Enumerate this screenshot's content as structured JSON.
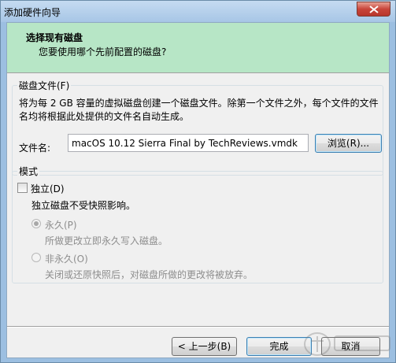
{
  "window": {
    "title": "添加硬件向导"
  },
  "header": {
    "title": "选择现有磁盘",
    "subtitle": "您要使用哪个先前配置的磁盘?"
  },
  "disk_file": {
    "group_label": "磁盘文件(F)",
    "description": "将为每 2 GB 容量的虚拟磁盘创建一个磁盘文件。除第一个文件之外，每个文件的文件名均将根据此处提供的文件名自动生成。",
    "file_label": "文件名:",
    "file_value": "macOS 10.12 Sierra Final by TechReviews.vmdk",
    "browse_label": "浏览(R)..."
  },
  "mode": {
    "group_label": "模式",
    "independent_label": "独立(D)",
    "independent_checked": false,
    "independent_desc": "独立磁盘不受快照影响。",
    "persistent_label": "永久(P)",
    "persistent_desc": "所做更改立即永久写入磁盘。",
    "nonpersistent_label": "非永久(O)",
    "nonpersistent_desc": "关闭或还原快照后，对磁盘所做的更改将被放弃。"
  },
  "footer": {
    "back_label": "< 上一步(B)",
    "finish_label": "完成",
    "cancel_label": "取消"
  },
  "colors": {
    "header_bg": "#b7e6c6",
    "frame": "#9cbfe1",
    "close_button": "#c8453a"
  },
  "icons": {
    "close": "close-x-icon"
  }
}
